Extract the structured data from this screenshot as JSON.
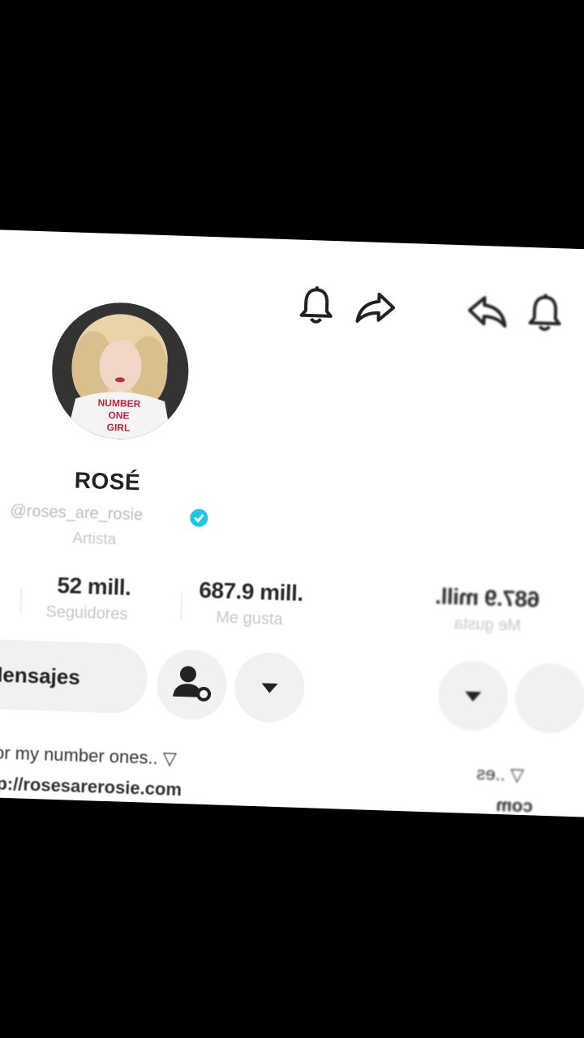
{
  "header": {
    "icons": [
      "bell-icon",
      "share-icon"
    ]
  },
  "profile": {
    "name": "ROSÉ",
    "handle": "@roses_are_rosie",
    "category": "Artista",
    "verified": true,
    "accent_color": "#20c6e8"
  },
  "stats": [
    {
      "value": "52 mill.",
      "label": "Seguidores"
    },
    {
      "value": "687.9 mill.",
      "label": "Me gusta"
    }
  ],
  "actions": {
    "message_label": "Mensajes",
    "icons": [
      "person-settings-icon",
      "dropdown-arrow-icon"
    ]
  },
  "bio": {
    "text": "e for my number ones.. ▽",
    "link": "http://rosesarerosie.com"
  },
  "ghost": {
    "stat_value": "687.9 mill.",
    "stat_label": "Me gusta",
    "bio_fragment": "▽ ..es",
    "link_fragment": "com"
  },
  "avatar_shirt": [
    "NUMBER",
    "ONE",
    "GIRL"
  ]
}
